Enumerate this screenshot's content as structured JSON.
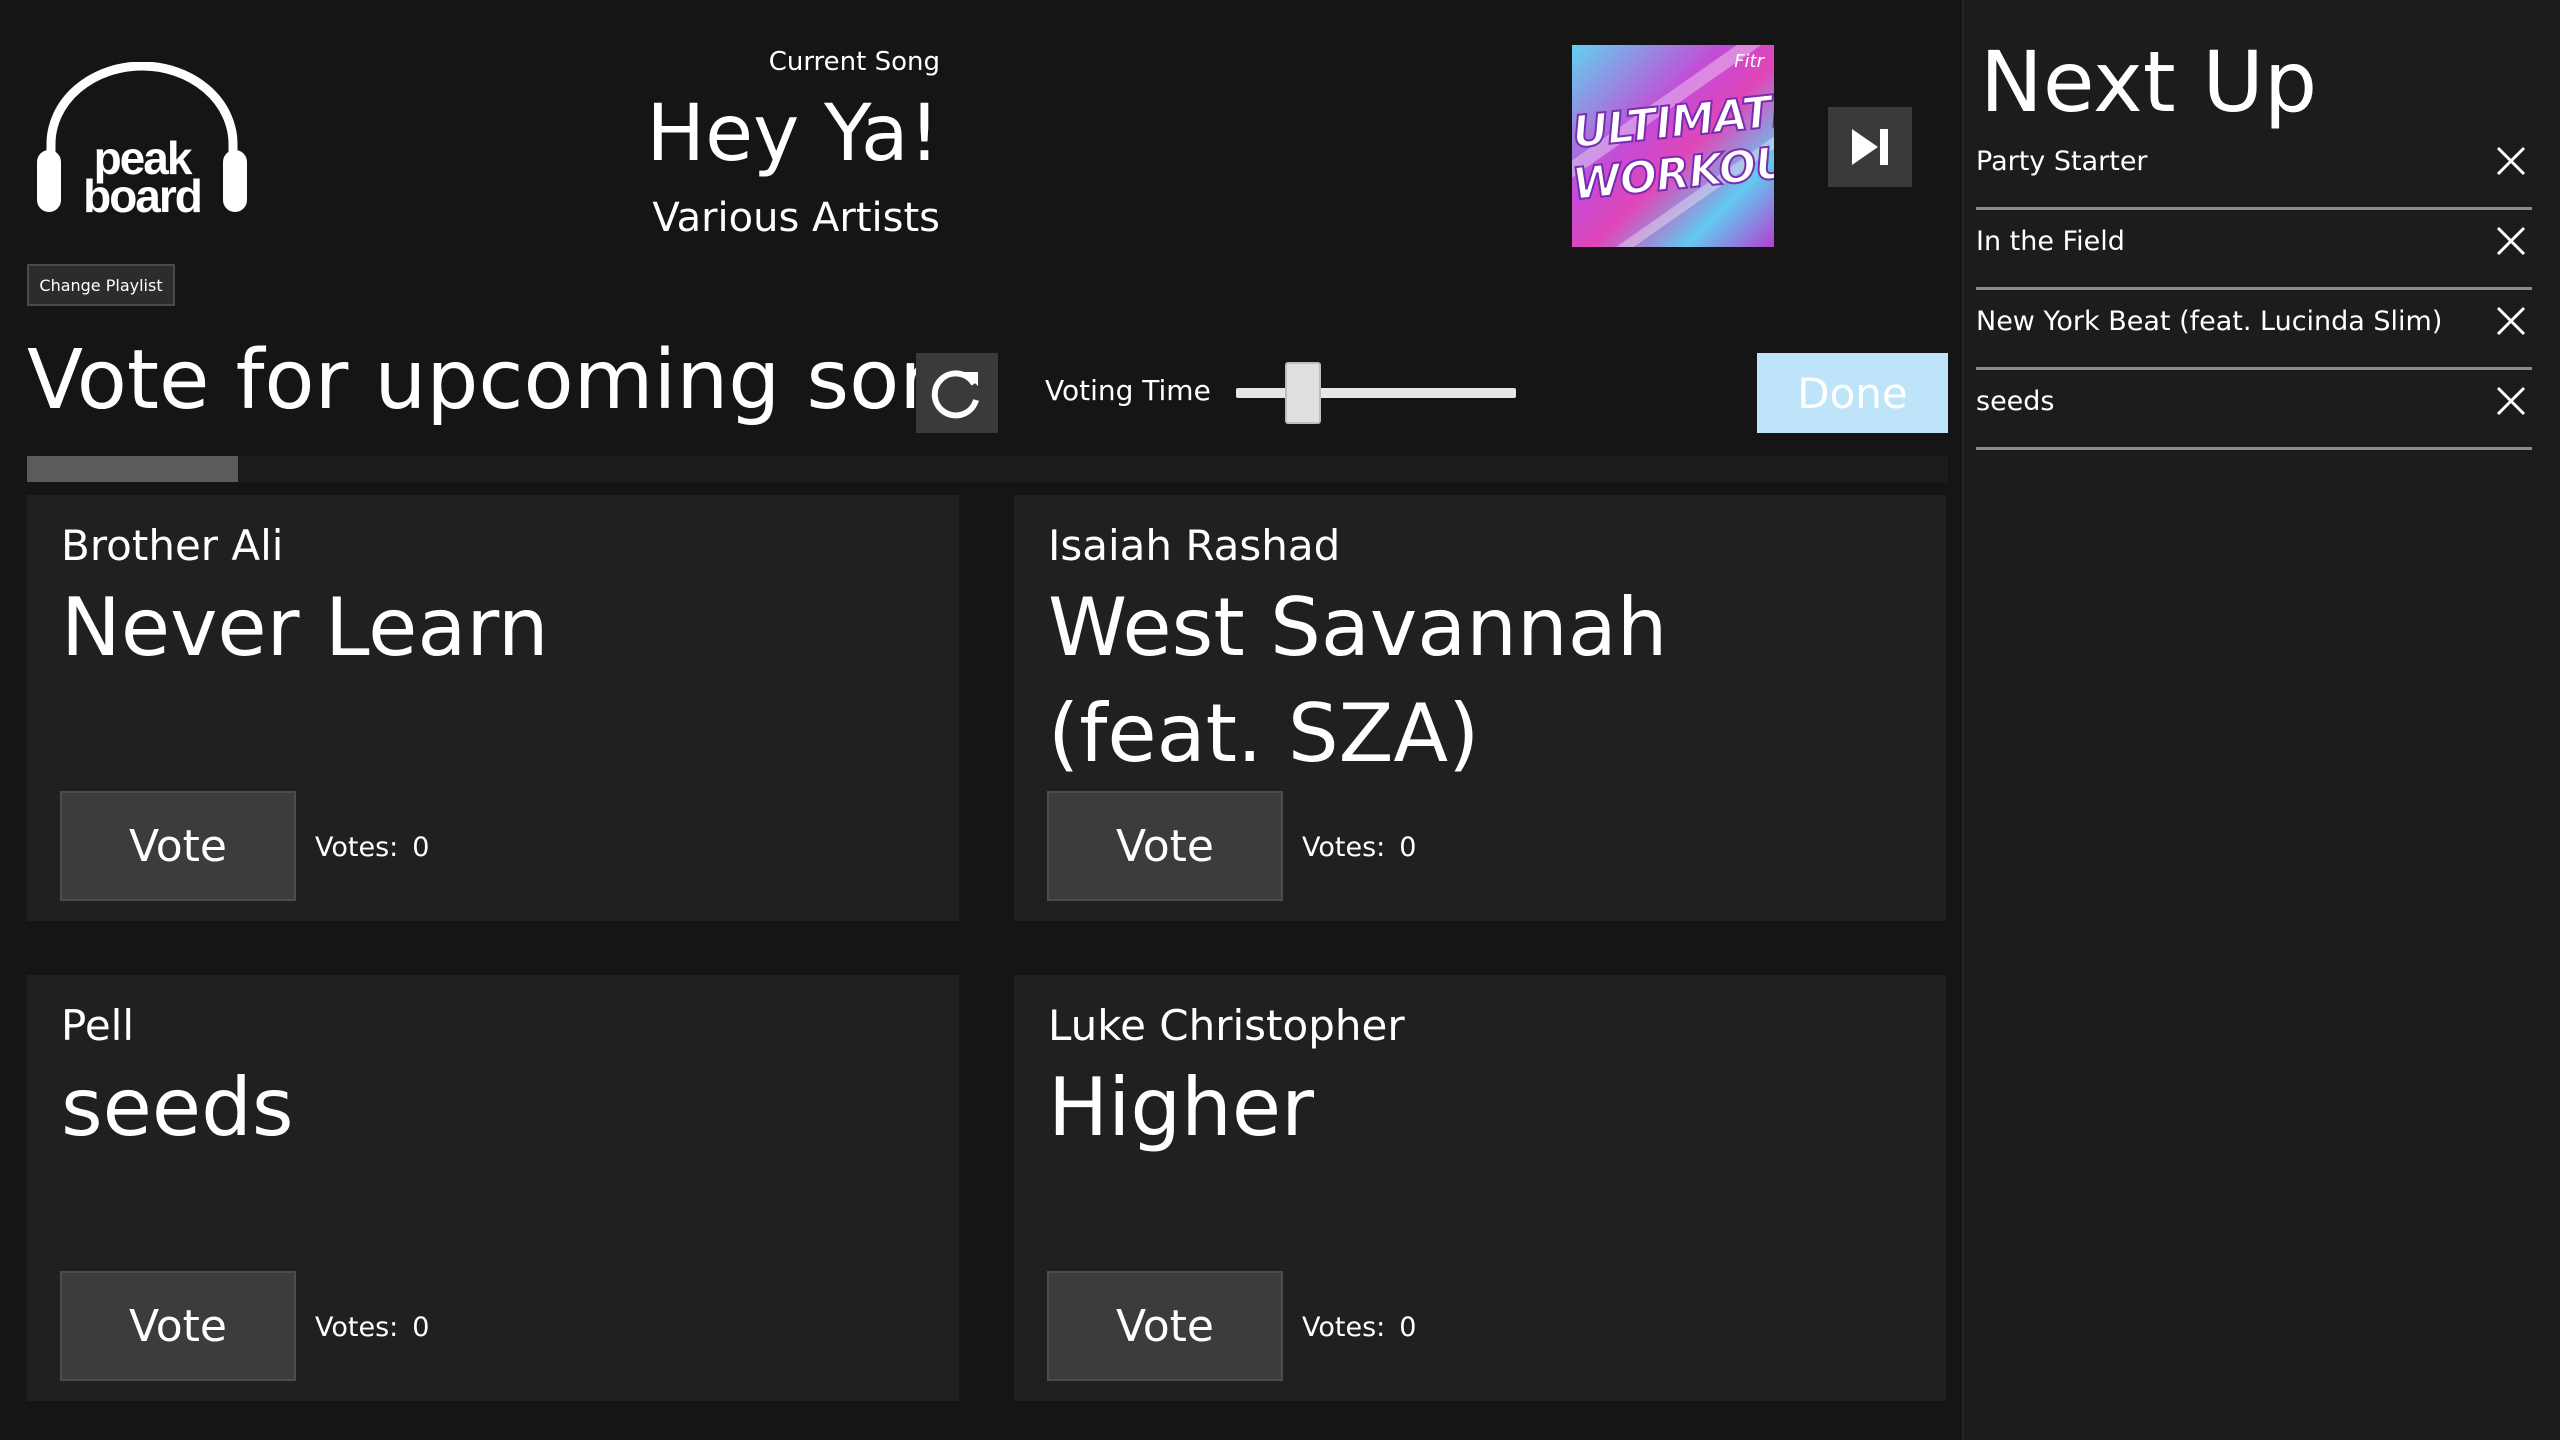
{
  "header": {
    "change_playlist_label": "Change Playlist",
    "current_song": {
      "label": "Current Song",
      "title": "Hey Ya!",
      "artist": "Various Artists",
      "album_art_text": [
        "ULTIMATE",
        "WORKOUT"
      ],
      "album_art_brand": "Fitr"
    }
  },
  "voting": {
    "heading": "Vote for upcoming song",
    "voting_time_label": "Voting Time",
    "voting_time_level": 0.2,
    "done_label": "Done",
    "progress": 0.11
  },
  "cards": [
    {
      "artist": "Brother Ali",
      "title": "Never Learn",
      "vote_label": "Vote",
      "votes_label": "Votes:",
      "votes": "0"
    },
    {
      "artist": "Isaiah Rashad",
      "title": "West Savannah (feat. SZA)",
      "vote_label": "Vote",
      "votes_label": "Votes:",
      "votes": "0"
    },
    {
      "artist": "Pell",
      "title": "seeds",
      "vote_label": "Vote",
      "votes_label": "Votes:",
      "votes": "0"
    },
    {
      "artist": "Luke Christopher",
      "title": "Higher",
      "vote_label": "Vote",
      "votes_label": "Votes:",
      "votes": "0"
    }
  ],
  "sidebar": {
    "title": "Next Up",
    "queue": [
      {
        "label": "Party Starter"
      },
      {
        "label": "In the Field"
      },
      {
        "label": "New York Beat (feat. Lucinda Slim)"
      },
      {
        "label": "seeds"
      }
    ]
  },
  "icons": {
    "logo": "peakboard-headphones-logo",
    "skip": "skip-next-icon",
    "refresh": "refresh-icon",
    "remove": "close-icon"
  },
  "colors": {
    "background": "#151515",
    "card": "#1f2021",
    "button": "#3c3c3c",
    "done": "#bde4f8",
    "sidebar": "#1b1c1d"
  }
}
